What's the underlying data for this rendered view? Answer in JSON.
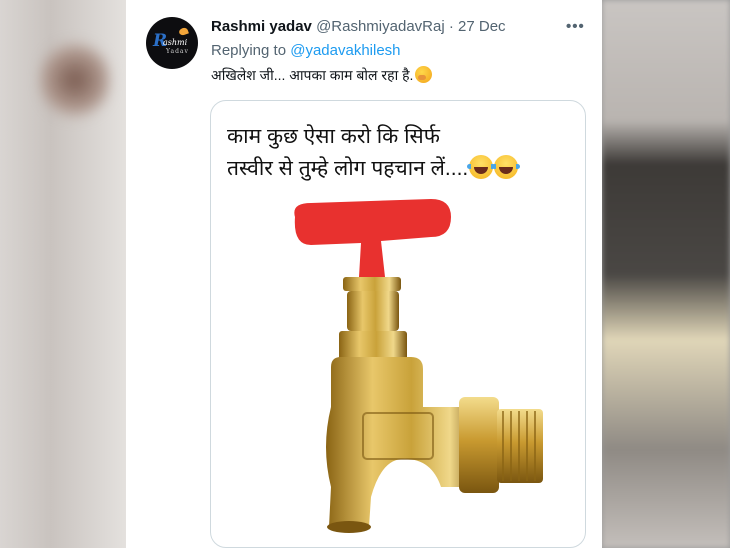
{
  "tweet": {
    "display_name": "Rashmi yadav",
    "handle": "@RashmiyadavRaj",
    "separator": "·",
    "date": "27 Dec",
    "more_label": "•••",
    "replying_prefix": "Replying to",
    "replying_to": "@yadavakhilesh",
    "text": "अखिलेश जी... आपका काम बोल रहा है.",
    "text_emoji": "face-with-hand-over-mouth-emoji"
  },
  "avatar": {
    "logo_letter": "R",
    "logo_rest": "ashmi",
    "logo_sub": "Yadav"
  },
  "media": {
    "caption_line1": "काम कुछ ऐसा करो कि सिर्फ",
    "caption_line2": "तस्वीर से तुम्हे लोग पहचान लें....",
    "caption_emoji": "tears-of-joy-emoji",
    "image_subject": "brass-tap-icon"
  },
  "colors": {
    "link": "#1d9bf0",
    "muted": "#536471",
    "tap_handle": "#e8312f",
    "brass": "#c9a23a"
  }
}
